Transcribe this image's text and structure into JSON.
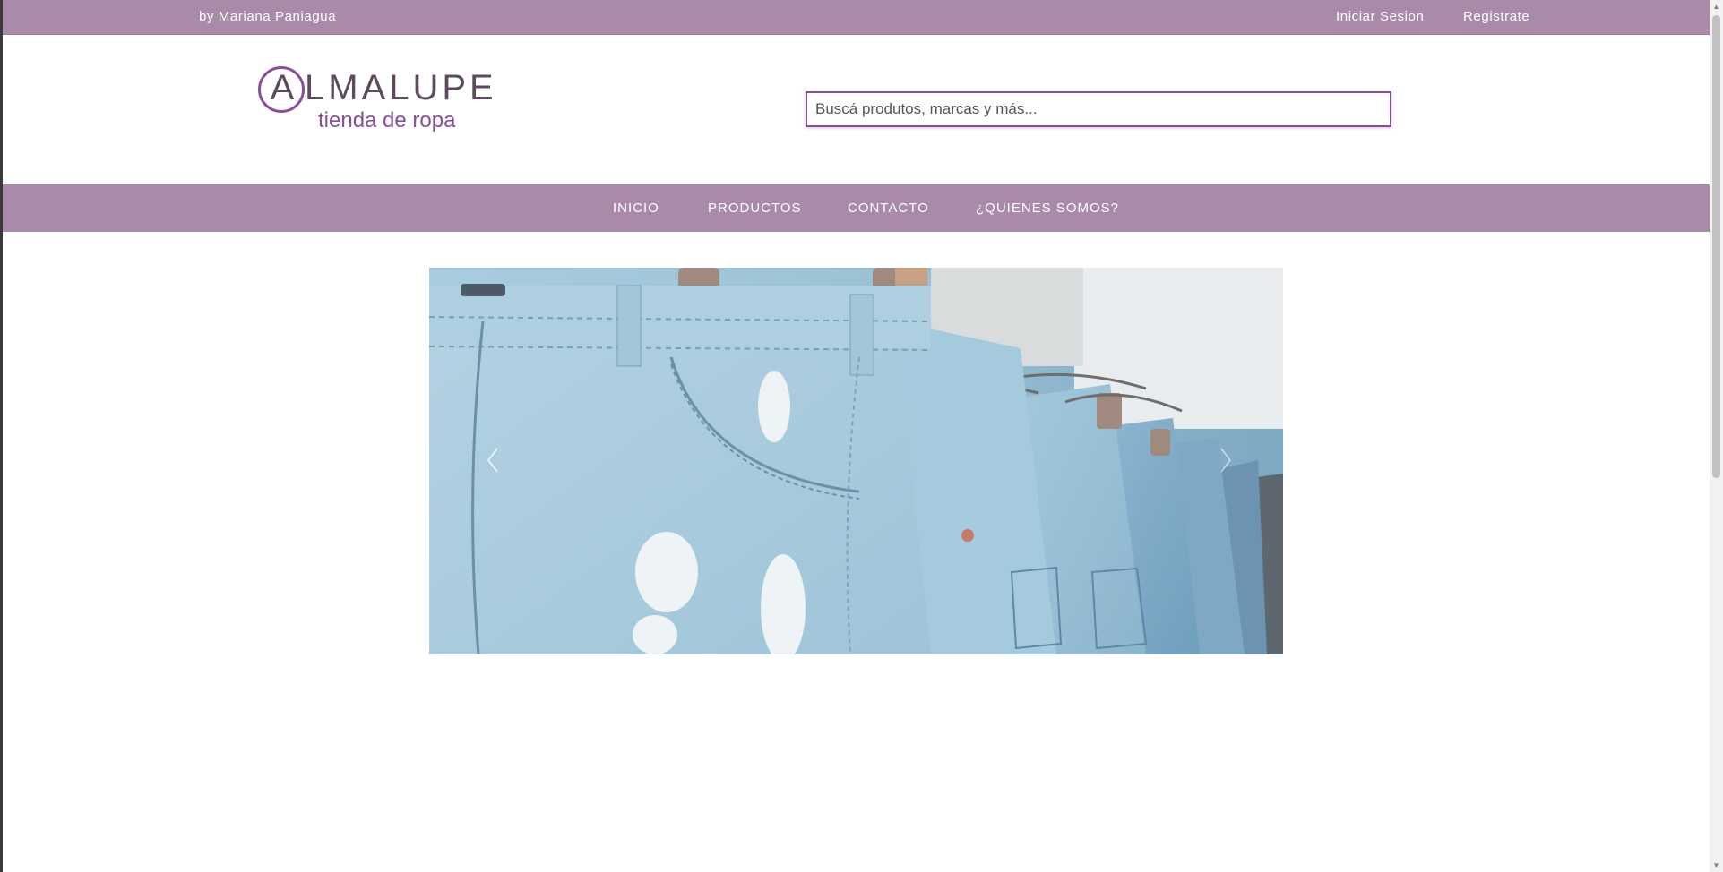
{
  "topbar": {
    "author": "by Mariana Paniagua",
    "login": "Iniciar Sesion",
    "register": "Registrate"
  },
  "logo": {
    "letter": "A",
    "rest": "LMALUPE",
    "tagline": "tienda de ropa"
  },
  "search": {
    "placeholder": "Buscá produtos, marcas y más..."
  },
  "nav": {
    "items": [
      "INICIO",
      "PRODUCTOS",
      "CONTACTO",
      "¿QUIENES SOMOS?"
    ]
  },
  "carousel": {
    "prev_icon": "chevron-left-icon",
    "next_icon": "chevron-right-icon"
  },
  "colors": {
    "brand_bar": "#a98aa9",
    "accent_purple": "#8a4d99",
    "logo_text": "#5d4a5d"
  }
}
